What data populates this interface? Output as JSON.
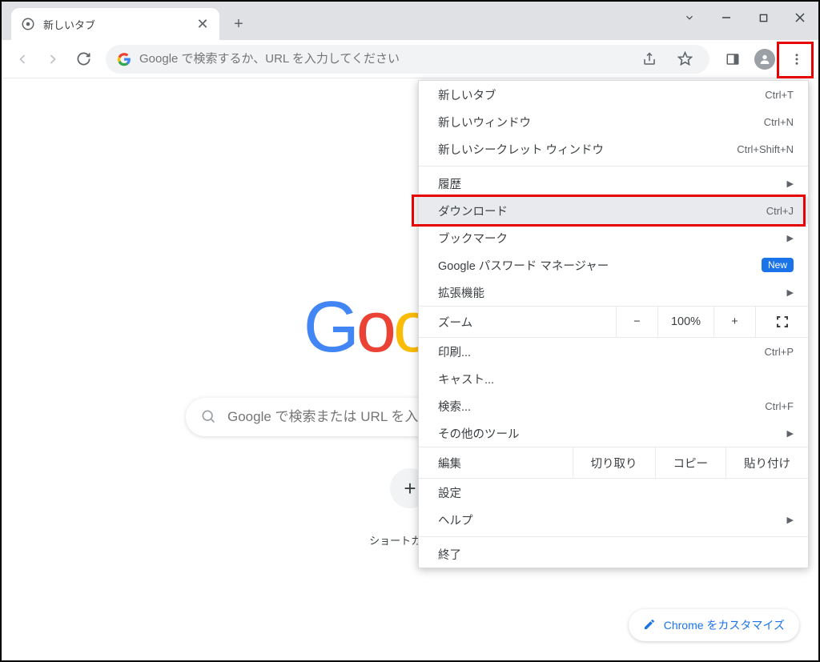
{
  "tab": {
    "title": "新しいタブ"
  },
  "omnibox": {
    "placeholder": "Google で検索するか、URL を入力してください"
  },
  "content": {
    "search_placeholder": "Google で検索または URL を入力",
    "shortcut_label": "ショートカット...",
    "customize_label": "Chrome をカスタマイズ"
  },
  "menu": {
    "new_tab": {
      "label": "新しいタブ",
      "shortcut": "Ctrl+T"
    },
    "new_window": {
      "label": "新しいウィンドウ",
      "shortcut": "Ctrl+N"
    },
    "incognito": {
      "label": "新しいシークレット ウィンドウ",
      "shortcut": "Ctrl+Shift+N"
    },
    "history": {
      "label": "履歴"
    },
    "downloads": {
      "label": "ダウンロード",
      "shortcut": "Ctrl+J"
    },
    "bookmarks": {
      "label": "ブックマーク"
    },
    "password": {
      "label": "Google パスワード マネージャー",
      "badge": "New"
    },
    "extensions": {
      "label": "拡張機能"
    },
    "zoom": {
      "label": "ズーム",
      "value": "100%"
    },
    "print": {
      "label": "印刷...",
      "shortcut": "Ctrl+P"
    },
    "cast": {
      "label": "キャスト..."
    },
    "find": {
      "label": "検索...",
      "shortcut": "Ctrl+F"
    },
    "more_tools": {
      "label": "その他のツール"
    },
    "edit": {
      "label": "編集",
      "cut": "切り取り",
      "copy": "コピー",
      "paste": "貼り付け"
    },
    "settings": {
      "label": "設定"
    },
    "help": {
      "label": "ヘルプ"
    },
    "exit": {
      "label": "終了"
    }
  }
}
